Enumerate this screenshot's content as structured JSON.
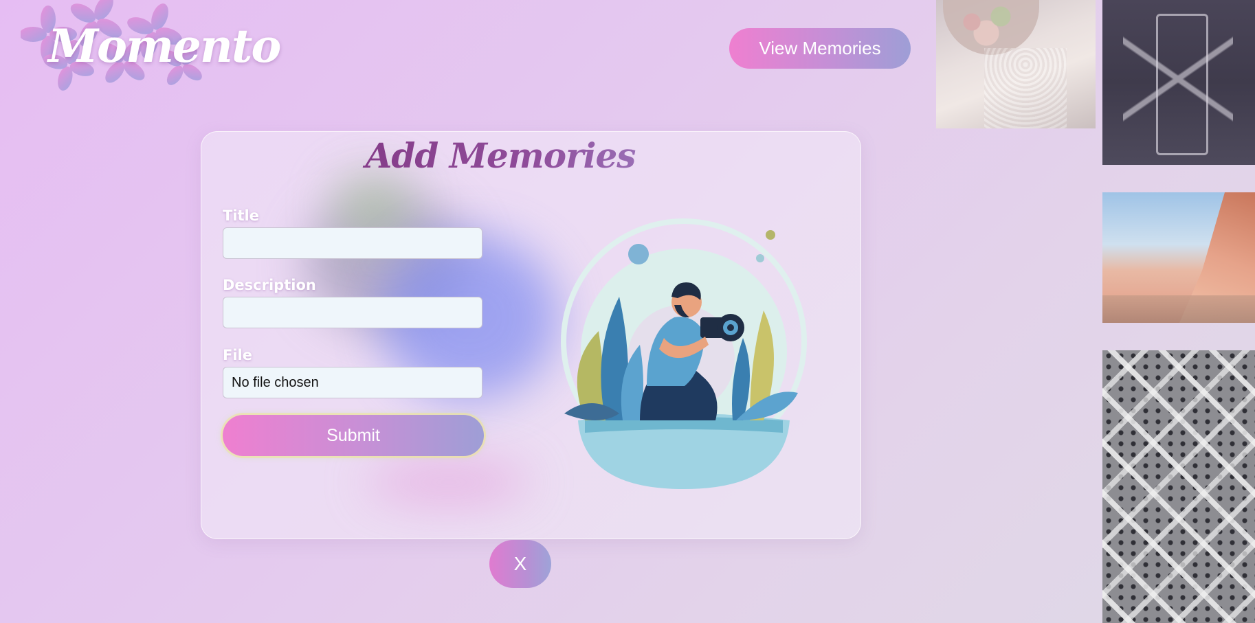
{
  "app": {
    "logo_text": "Momento"
  },
  "header": {
    "view_memories_label": "View Memories"
  },
  "form": {
    "title": "Add Memories",
    "fields": {
      "title_label": "Title",
      "title_value": "",
      "description_label": "Description",
      "description_value": "",
      "file_label": "File",
      "file_status": "No file chosen"
    },
    "submit_label": "Submit",
    "close_label": "X"
  },
  "illustration": {
    "icon": "photographer-illustration"
  },
  "gallery": {
    "photos": [
      "wedding-bouquet-photo",
      "mirror-reflection-photo",
      "canyon-photo",
      "crosswalk-crowd-photo"
    ]
  },
  "colors": {
    "accent_pink": "#ef7fd0",
    "accent_lavender": "#9e9ed6",
    "title_purple": "#7c2d79",
    "input_bg": "#eff6fb"
  }
}
